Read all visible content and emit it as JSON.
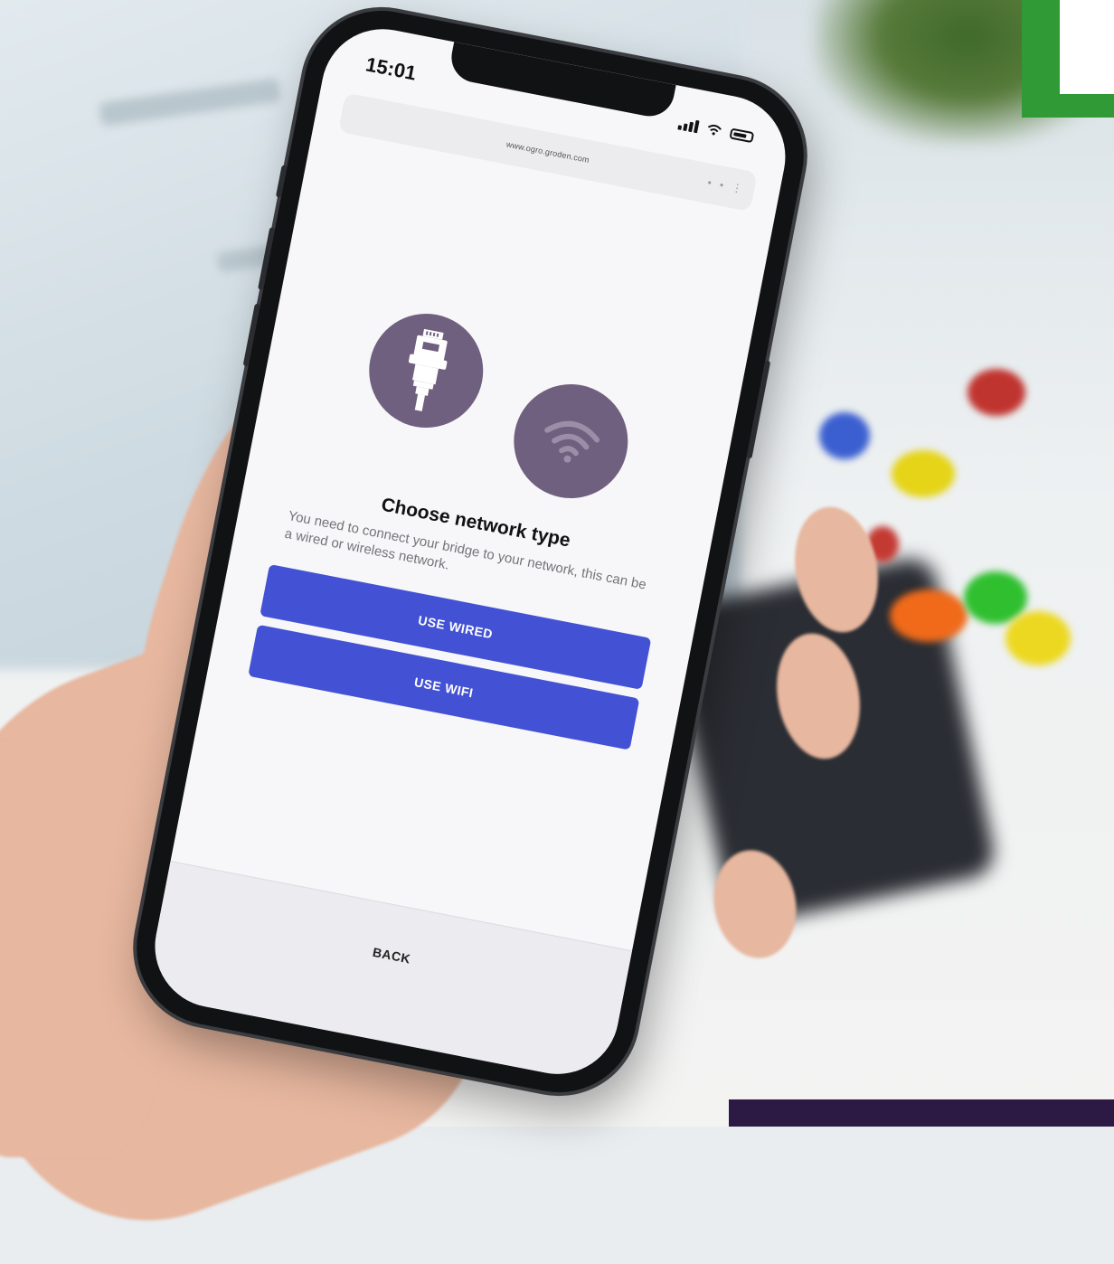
{
  "status_bar": {
    "time": "15:01"
  },
  "browser": {
    "url": "www.ogro.groden.com"
  },
  "page": {
    "title": "Choose network type",
    "description": "You need to connect your bridge to your network, this can be a wired or wireless network.",
    "options": [
      {
        "icon": "ethernet-plug-icon",
        "label": "Wired"
      },
      {
        "icon": "wifi-icon",
        "label": "WiFi"
      }
    ],
    "use_wired_label": "USE WIRED",
    "use_wifi_label": "USE WIFI",
    "back_label": "BACK"
  },
  "colors": {
    "primary_button": "#4352d4",
    "icon_circle": "#70607f",
    "screen_background": "#f7f6f8",
    "logo_green": "#2f9a36",
    "footer_bar": "#2c1a44"
  }
}
